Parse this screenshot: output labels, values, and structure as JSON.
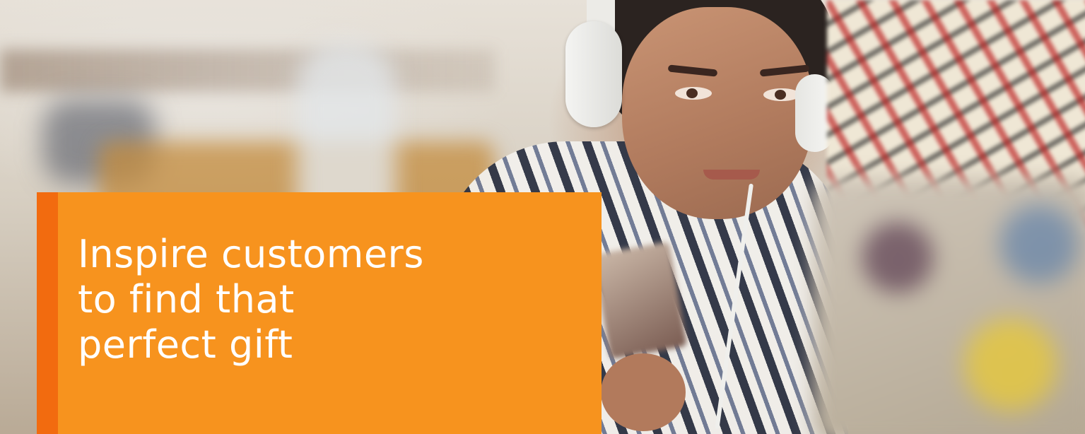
{
  "hero": {
    "headline_lines": [
      "Inspire customers",
      "to find that",
      "perfect gift"
    ]
  },
  "colors": {
    "panel": "#f7931e",
    "panel_accent": "#f26b0f",
    "headline_text": "#ffffff"
  },
  "icons": []
}
